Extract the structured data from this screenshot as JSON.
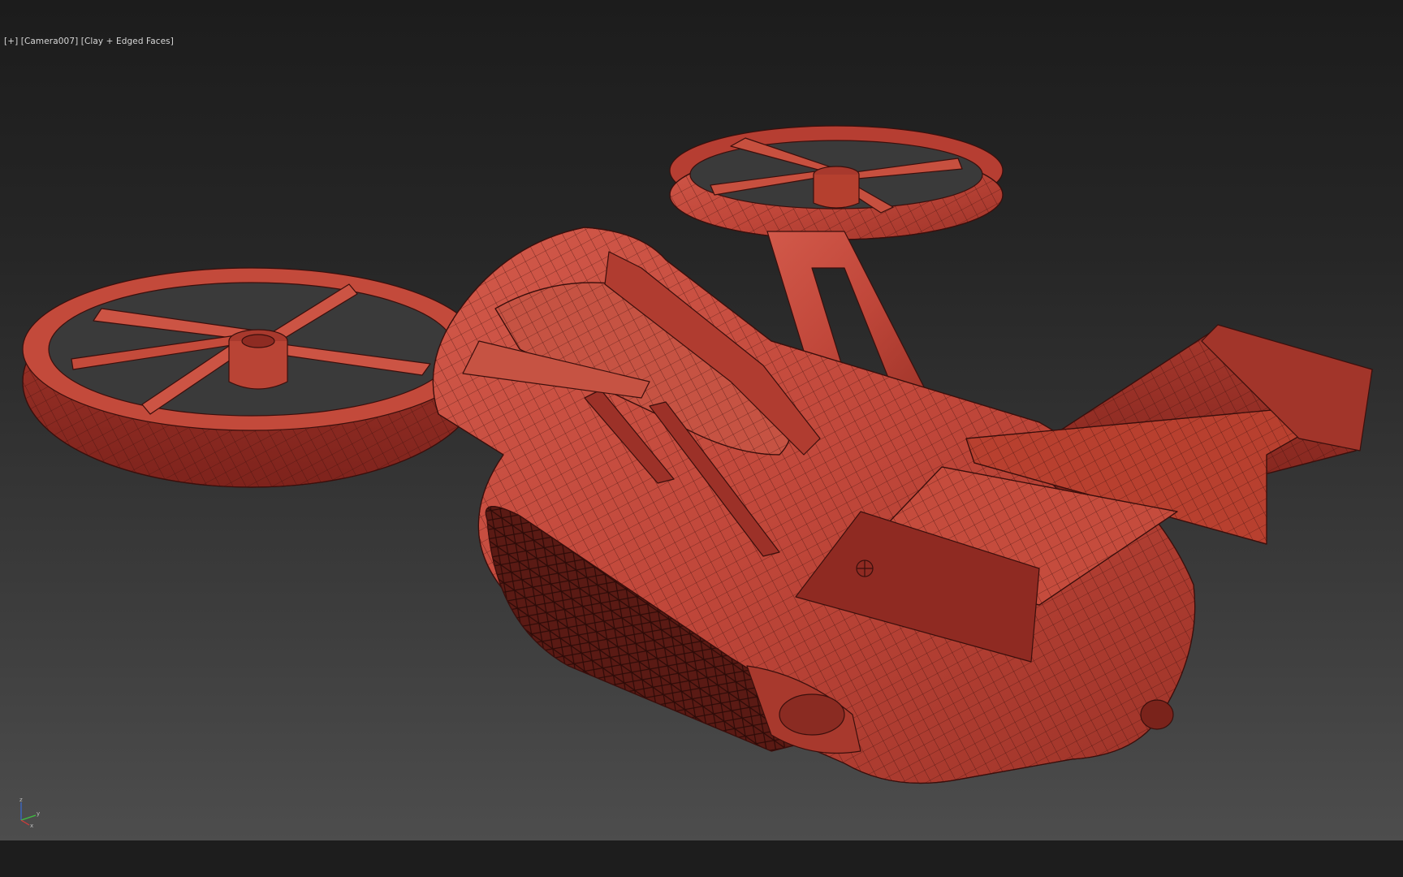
{
  "viewport": {
    "label_parts": [
      "[+]",
      "[Camera007]",
      "[Clay + Edged Faces]"
    ],
    "shading_mode": "Clay + Edged Faces",
    "camera": "Camera007"
  },
  "scene": {
    "object": "sci-fi VTOL aircraft",
    "material_color": "#c2463a",
    "edge_color": "#3a0f0c"
  },
  "gizmo": {
    "axis_z": "z",
    "axis_x": "x",
    "axis_y": "y"
  },
  "colors": {
    "viewport_top": "#1c1c1c",
    "viewport_bottom": "#4d4d4d",
    "frame": "#1d1d1d"
  }
}
